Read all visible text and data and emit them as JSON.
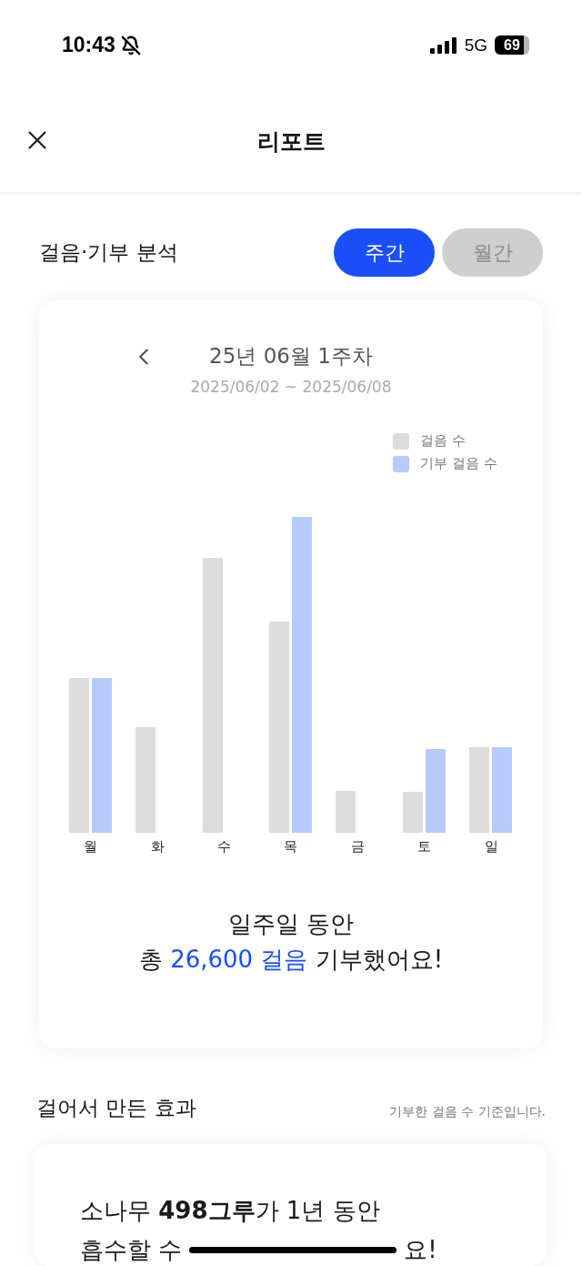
{
  "status_bar": {
    "time": "10:43",
    "network": "5G",
    "battery": "69"
  },
  "header": {
    "title": "리포트"
  },
  "analysis": {
    "title": "걸음·기부 분석",
    "tabs": [
      {
        "label": "주간",
        "selected": true
      },
      {
        "label": "월간",
        "selected": false
      }
    ],
    "period": {
      "title": "25년 06월 1주차",
      "range": "2025/06/02 ~ 2025/06/08"
    },
    "legend": [
      {
        "label": "걸음 수",
        "color": "#dcdcdc"
      },
      {
        "label": "기부 걸음 수",
        "color": "#b6cbfb"
      }
    ],
    "days": [
      "월",
      "화",
      "수",
      "목",
      "금",
      "토",
      "일"
    ],
    "summary_line1": "일주일 동안",
    "summary_line2": {
      "before": "총",
      "highlight": "26,600 걸음",
      "after": "기부했어요!"
    }
  },
  "effect": {
    "title": "걸어서 만든 효과",
    "note": "기부한 걸음 수 기준입니다.",
    "line1": "소나무 **498그루**가 1년 동안",
    "line2_start": "흡수할 수",
    "line2_end": "요!"
  }
}
